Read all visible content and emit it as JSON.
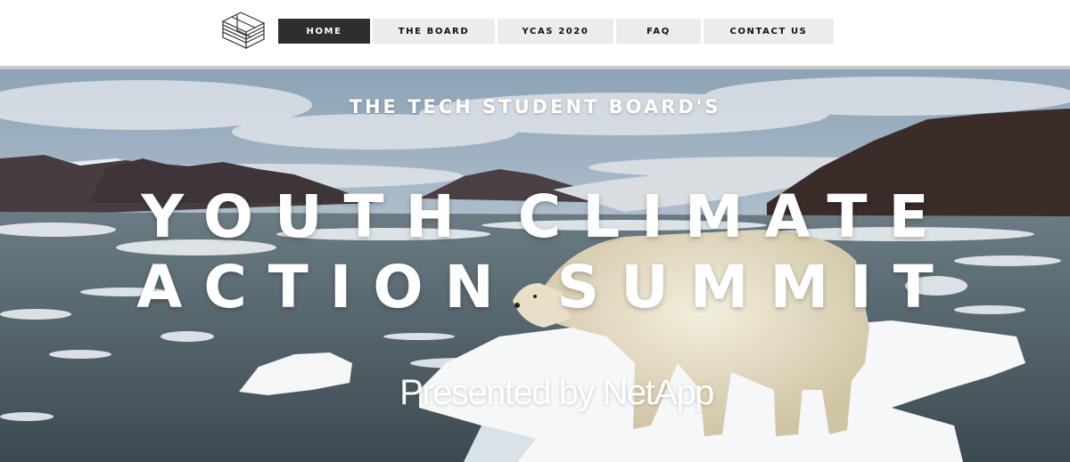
{
  "nav": {
    "items": [
      {
        "label": "HOME",
        "active": true
      },
      {
        "label": "THE BOARD",
        "active": false
      },
      {
        "label": "YCAS 2020",
        "active": false
      },
      {
        "label": "FAQ",
        "active": false
      },
      {
        "label": "CONTACT US",
        "active": false
      }
    ]
  },
  "logo": {
    "icon": "isometric-block-logo"
  },
  "hero": {
    "kicker": "THE TECH STUDENT BOARD'S",
    "title_line1": "YOUTH CLIMATE",
    "title_line2": "ACTION SUMMIT",
    "subtitle": "Presented by NetApp",
    "image": "polar-bear-on-ice-floe"
  },
  "colors": {
    "nav_active_bg": "#2e2e2e",
    "nav_bg": "#ececec",
    "hero_text": "#ffffff"
  }
}
